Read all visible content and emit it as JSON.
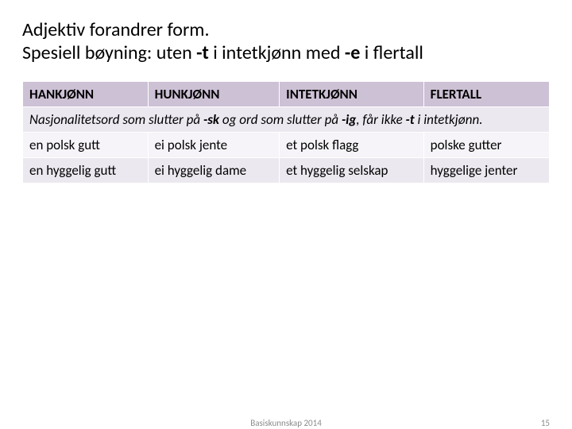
{
  "title": {
    "line1": "Adjektiv forandrer form.",
    "line2_a": "Spesiell bøyning: uten ",
    "line2_b": "-t",
    "line2_c": " i intetkjønn med ",
    "line2_d": "-e",
    "line2_e": " i flertall"
  },
  "headers": [
    "HANKJØNN",
    "HUNKJØNN",
    "INTETKJØNN",
    "FLERTALL"
  ],
  "note": {
    "a": "Nasjonalitetsord som slutter på ",
    "b": "-sk",
    "c": " og ord som slutter på ",
    "d": "-ig",
    "e": ", får ikke ",
    "f": "-t",
    "g": " i intetkjønn."
  },
  "rows": [
    [
      "en polsk gutt",
      "ei polsk jente",
      "et polsk flagg",
      "polske gutter"
    ],
    [
      "en hyggelig gutt",
      "ei hyggelig dame",
      "et hyggelig selskap",
      "hyggelige jenter"
    ]
  ],
  "footer": {
    "center": "Basiskunnskap 2014",
    "right": "15"
  }
}
